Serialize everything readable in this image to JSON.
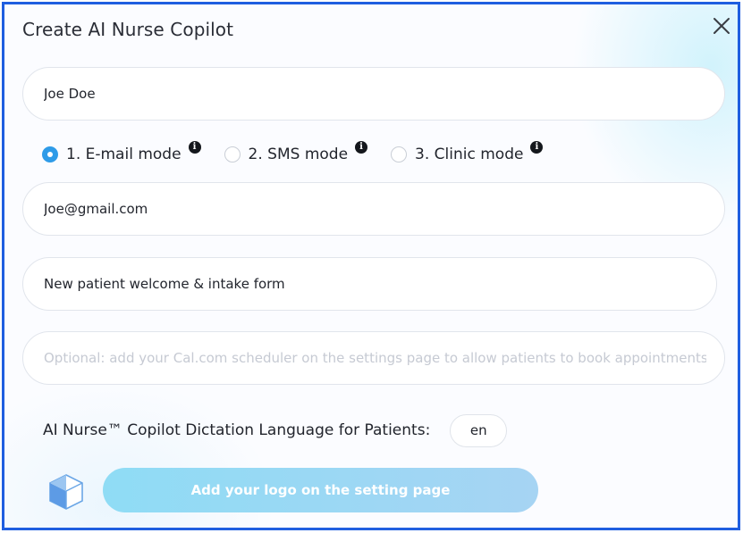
{
  "dialog": {
    "title": "Create AI Nurse Copilot",
    "close_icon": "close-icon"
  },
  "form": {
    "name_value": "Joe Doe",
    "modes": [
      {
        "label": "1. E-mail mode",
        "selected": true,
        "info_icon": "info-icon"
      },
      {
        "label": "2. SMS mode",
        "selected": false,
        "info_icon": "info-icon"
      },
      {
        "label": "3. Clinic mode",
        "selected": false,
        "info_icon": "info-icon"
      }
    ],
    "email_value": "Joe@gmail.com",
    "form_type_value": "New patient welcome & intake form",
    "scheduler_placeholder": "Optional: add your Cal.com scheduler on the settings page to allow patients to book appointments",
    "language_label": "AI Nurse™ Copilot Dictation Language for Patients:",
    "language_value": "en"
  },
  "logo": {
    "icon": "cube-logo-icon",
    "button_label": "Add your logo on the setting page"
  },
  "colors": {
    "border": "#1f5ee0",
    "radio_selected": "#2e9be8",
    "button_gradient_start": "#8fdcf5",
    "button_gradient_end": "#a6d4f3"
  }
}
